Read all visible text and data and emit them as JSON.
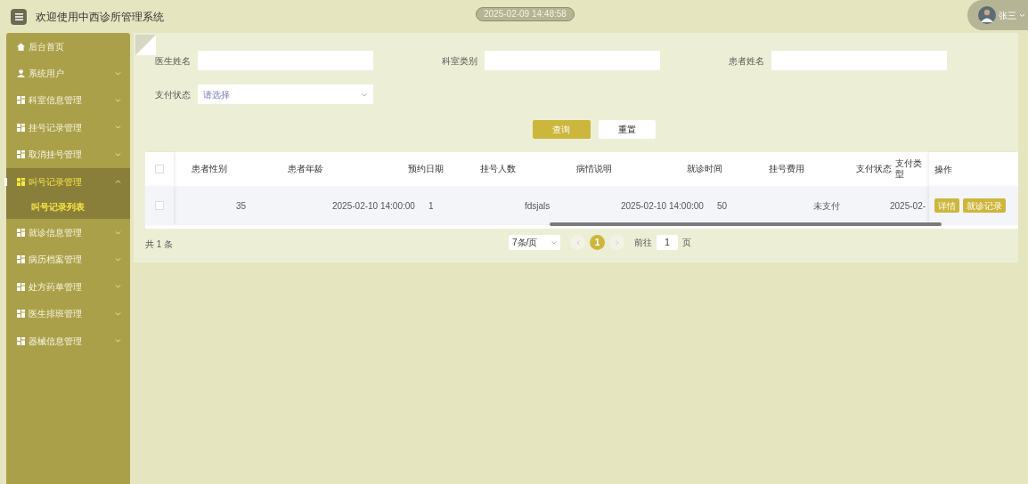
{
  "header": {
    "title": "欢迎使用中西诊所管理系统",
    "datetime": "2025-02-09 14:48:58",
    "user": "张三"
  },
  "sidebar": {
    "items": [
      {
        "label": "后台首页",
        "selected": false
      },
      {
        "label": "系统用户",
        "expanded": false,
        "selected": false
      },
      {
        "label": "科室信息管理",
        "expanded": false,
        "selected": false
      },
      {
        "label": "挂号记录管理",
        "expanded": false,
        "selected": false
      },
      {
        "label": "取消挂号管理",
        "expanded": false,
        "selected": false
      },
      {
        "label": "叫号记录管理",
        "expanded": true,
        "selected": true,
        "children": [
          {
            "label": "叫号记录列表",
            "selected": true
          }
        ]
      },
      {
        "label": "就诊信息管理",
        "expanded": false,
        "selected": false
      },
      {
        "label": "病历档案管理",
        "expanded": false,
        "selected": false
      },
      {
        "label": "处方药单管理",
        "expanded": false,
        "selected": false
      },
      {
        "label": "医生排班管理",
        "expanded": false,
        "selected": false
      },
      {
        "label": "器械信息管理",
        "expanded": false,
        "selected": false
      }
    ]
  },
  "filters": [
    {
      "kind": "text",
      "label": "医生姓名"
    },
    {
      "kind": "text",
      "label": "科室类别"
    },
    {
      "kind": "text",
      "label": "患者姓名"
    },
    {
      "kind": "select",
      "label": "支付状态",
      "placeholder": "请选择"
    }
  ],
  "buttons": {
    "search": "查询",
    "reset": "重置"
  },
  "table": {
    "all_checked": false,
    "columns": [
      "患者性别",
      "患者年龄",
      "预约日期",
      "挂号人数",
      "病情说明",
      "就诊时间",
      "挂号费用",
      "支付状态",
      "支付类型",
      "操作"
    ],
    "rows": [
      {
        "checked": false,
        "cells": [
          "35",
          "2025-02-10 14:00:00",
          "1",
          "fdsjals",
          "2025-02-10 14:00:00",
          "50",
          "未支付",
          "",
          "2025-02-"
        ],
        "actions": [
          "详情",
          "就诊记录"
        ]
      }
    ]
  },
  "pagination": {
    "total": "共 1 条",
    "page_size": "7条/页",
    "pages": [
      {
        "label": "1",
        "selected": true
      }
    ],
    "goto_label": "前往",
    "goto_value": "1",
    "goto_suffix": "页"
  }
}
